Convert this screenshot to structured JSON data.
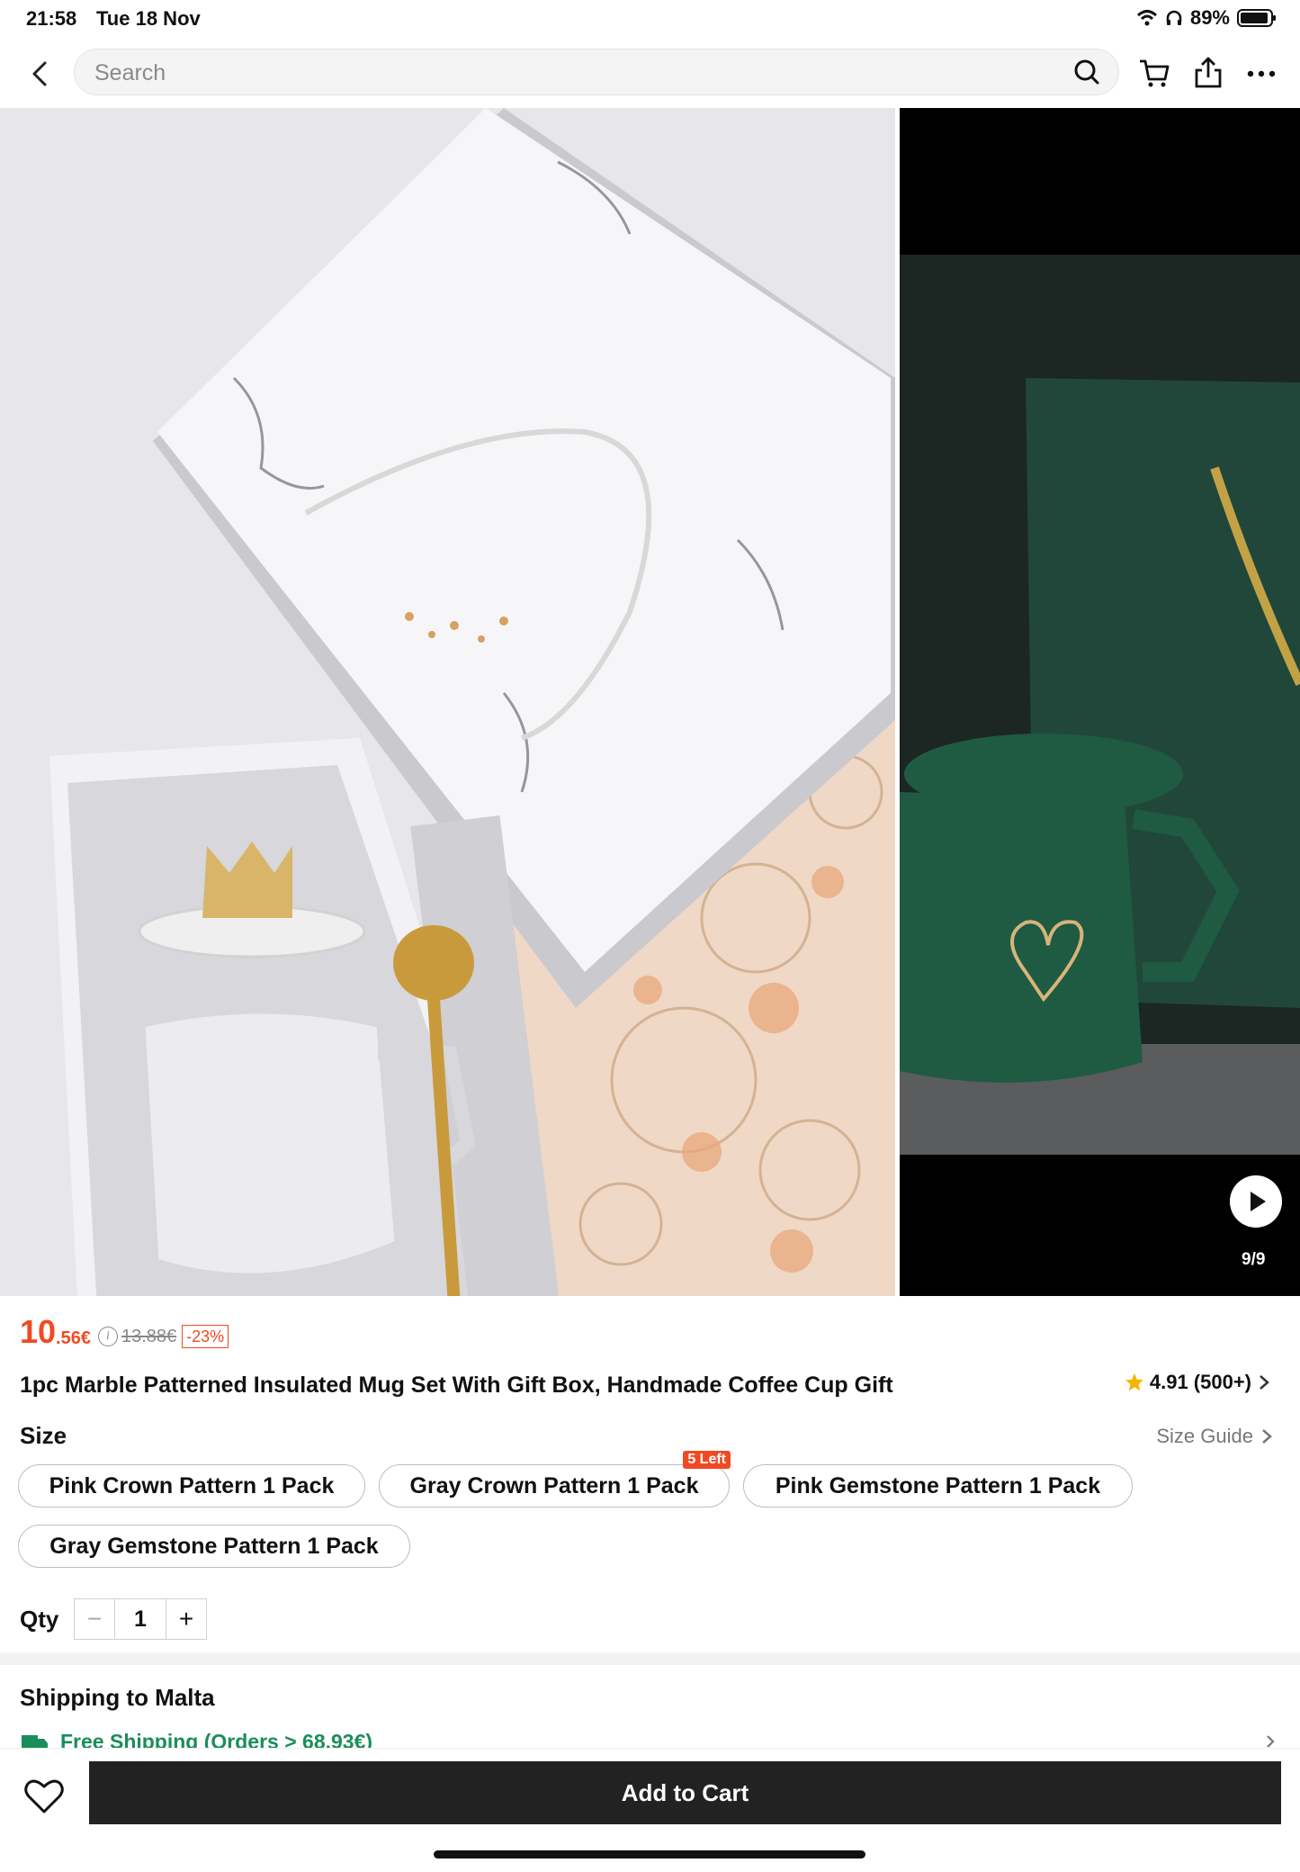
{
  "status_bar": {
    "time": "21:58",
    "date": "Tue 18 Nov",
    "battery": "89%"
  },
  "search": {
    "placeholder": "Search"
  },
  "gallery": {
    "counter": "9/9"
  },
  "product": {
    "price_int": "10",
    "price_dec": ".56€",
    "info": "i",
    "old_price": "13.88€",
    "discount": "-23%",
    "title": "1pc Marble Patterned Insulated Mug Set With Gift Box, Handmade Coffee Cup Gift",
    "rating": "4.91 (500+)"
  },
  "size": {
    "label": "Size",
    "guide": "Size Guide",
    "options": [
      {
        "label": "Pink Crown Pattern 1 Pack"
      },
      {
        "label": "Gray Crown Pattern 1 Pack",
        "badge": "5 Left"
      },
      {
        "label": "Pink Gemstone Pattern 1 Pack"
      },
      {
        "label": "Gray Gemstone Pattern 1 Pack"
      }
    ]
  },
  "qty": {
    "label": "Qty",
    "value": "1",
    "minus": "−",
    "plus": "+"
  },
  "shipping": {
    "title": "Shipping to Malta",
    "free": "Free Shipping (Orders > 68.93€)"
  },
  "actions": {
    "add_to_cart": "Add to Cart"
  },
  "colors": {
    "accent": "#f04a23",
    "shipping_green": "#1a8e5a",
    "cart_button": "#222222"
  },
  "icons": [
    "back-icon",
    "search-icon",
    "cart-icon",
    "share-icon",
    "more-icon",
    "play-icon",
    "star-icon",
    "heart-icon",
    "truck-icon",
    "wifi-icon",
    "headphones-icon",
    "battery-icon"
  ]
}
